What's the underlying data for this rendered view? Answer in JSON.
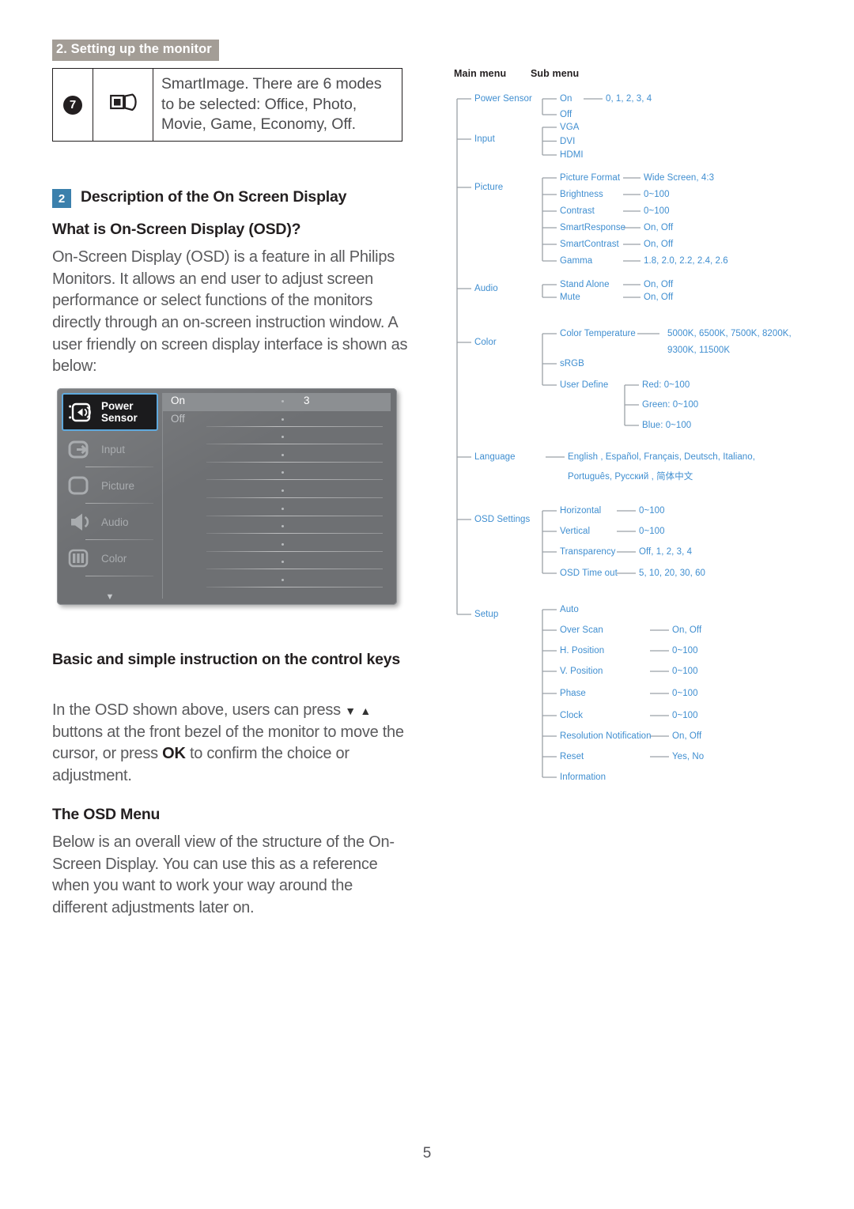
{
  "header": {
    "running_title": "2. Setting up the monitor"
  },
  "key_table": {
    "number": "7",
    "icon": "smartimage-icon",
    "description": "SmartImage. There are 6 modes to be selected: Office, Photo, Movie, Game, Economy, Off."
  },
  "section": {
    "badge": "2",
    "title": "Description of the On Screen Display",
    "sub_heading_1": "What is On-Screen Display (OSD)?",
    "paragraph_1": "On-Screen Display (OSD) is a feature in all Philips Monitors. It allows an end user to adjust screen performance or select functions of the monitors directly through an on-screen instruction window. A user friendly on screen display interface is shown as below:",
    "sub_heading_2": "Basic and simple instruction on the control keys",
    "paragraph_2_a": "In the OSD shown above, users can press ",
    "paragraph_2_down": "▼",
    "paragraph_2_up": "▲",
    "paragraph_2_b": " buttons at the front bezel of the monitor to move the cursor, or press ",
    "paragraph_2_ok": "OK",
    "paragraph_2_c": " to confirm the choice or adjustment.",
    "sub_heading_3": "The OSD Menu",
    "paragraph_3": "Below is an overall view of the structure of the On-Screen Display. You can use this as a reference when you want to work your way around the different adjustments later on."
  },
  "osd_mock": {
    "menu_items": [
      {
        "label": "Power Sensor",
        "icon": "power-sensor-icon",
        "active": true
      },
      {
        "label": "Input",
        "icon": "input-icon",
        "active": false
      },
      {
        "label": "Picture",
        "icon": "picture-icon",
        "active": false
      },
      {
        "label": "Audio",
        "icon": "audio-icon",
        "active": false
      },
      {
        "label": "Color",
        "icon": "color-icon",
        "active": false
      }
    ],
    "scroll_down": "▼",
    "options": [
      {
        "label": "On",
        "selected": true,
        "value": "3"
      },
      {
        "label": "Off",
        "selected": false,
        "value": ""
      }
    ]
  },
  "tree": {
    "col_headers": {
      "main": "Main menu",
      "sub": "Sub menu"
    },
    "main_items": [
      "Power Sensor",
      "Input",
      "Picture",
      "Audio",
      "Color",
      "Language",
      "OSD Settings",
      "Setup"
    ],
    "sub_items": {
      "power_sensor": [
        "On",
        "Off"
      ],
      "input": [
        "VGA",
        "DVI",
        "HDMI"
      ],
      "picture": [
        "Picture Format",
        "Brightness",
        "Contrast",
        "SmartResponse",
        "SmartContrast",
        "Gamma"
      ],
      "audio": [
        "Stand Alone",
        "Mute"
      ],
      "color": [
        "Color Temperature",
        "sRGB",
        "User Define"
      ],
      "color_user_define": [
        "Red: 0~100",
        "Green: 0~100",
        "Blue: 0~100"
      ],
      "osd_settings": [
        "Horizontal",
        "Vertical",
        "Transparency",
        "OSD Time out"
      ],
      "setup": [
        "Auto",
        "Over Scan",
        "H. Position",
        "V. Position",
        "Phase",
        "Clock",
        "Resolution Notification",
        "Reset",
        "Information"
      ]
    },
    "values": {
      "power_sensor_on": "0, 1, 2, 3, 4",
      "picture_format": "Wide Screen, 4:3",
      "brightness": "0~100",
      "contrast": "0~100",
      "smart_response": "On, Off",
      "smart_contrast": "On, Off",
      "gamma": "1.8, 2.0, 2.2, 2.4, 2.6",
      "stand_alone": "On, Off",
      "mute": "On, Off",
      "color_temperature_line1": "5000K, 6500K, 7500K, 8200K,",
      "color_temperature_line2": "9300K, 11500K",
      "language_line1": "English , Español, Français, Deutsch, Italiano,",
      "language_line2": "Português, Русский , 简体中文",
      "osd_horizontal": "0~100",
      "osd_vertical": "0~100",
      "osd_transparency": "Off, 1, 2, 3, 4",
      "osd_time_out": "5, 10, 20, 30, 60",
      "over_scan": "On, Off",
      "h_position": "0~100",
      "v_position": "0~100",
      "phase": "0~100",
      "clock": "0~100",
      "resolution_notification": "On, Off",
      "reset": "Yes, No"
    }
  },
  "footer": {
    "page_number": "5"
  },
  "colors": {
    "running_header_bg": "#a39d96",
    "section_badge_bg": "#3b80ac",
    "tree_text": "#3f8ed0",
    "tree_line": "#9aa0a6",
    "body_text": "#5a5a5c",
    "heading_text": "#231f20",
    "osd_bg": "#6e7073",
    "osd_highlight": "#5fa9dd"
  }
}
